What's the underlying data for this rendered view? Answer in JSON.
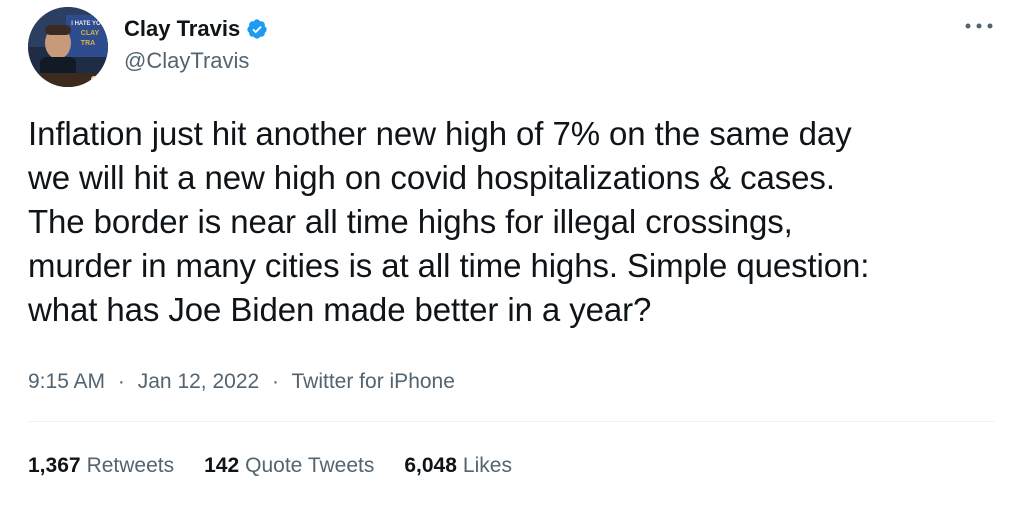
{
  "author": {
    "display_name": "Clay Travis",
    "handle": "@ClayTravis",
    "verified": true,
    "avatar_icon": "profile-photo",
    "avatar_sign_text": "I HATE YOU CLAY TRAVIS"
  },
  "tweet": {
    "lines": [
      "Inflation just hit another new high of 7% on the same day",
      "we will hit a new high on covid hospitalizations & cases.",
      "The border is near all time highs for illegal crossings,",
      "murder in many cities is at all time highs. Simple question:",
      "what has Joe Biden made better in a year?"
    ],
    "time": "9:15 AM",
    "date": "Jan 12, 2022",
    "source": "Twitter for iPhone",
    "separator": "·"
  },
  "stats": {
    "retweets": {
      "count": "1,367",
      "label": "Retweets"
    },
    "quote_tweets": {
      "count": "142",
      "label": "Quote Tweets"
    },
    "likes": {
      "count": "6,048",
      "label": "Likes"
    }
  },
  "colors": {
    "text": "#0f1419",
    "secondary": "#536471",
    "verified": "#1d9bf0",
    "divider": "#eff3f4"
  },
  "icons": {
    "more": "more-icon",
    "verified": "verified-badge-icon"
  }
}
